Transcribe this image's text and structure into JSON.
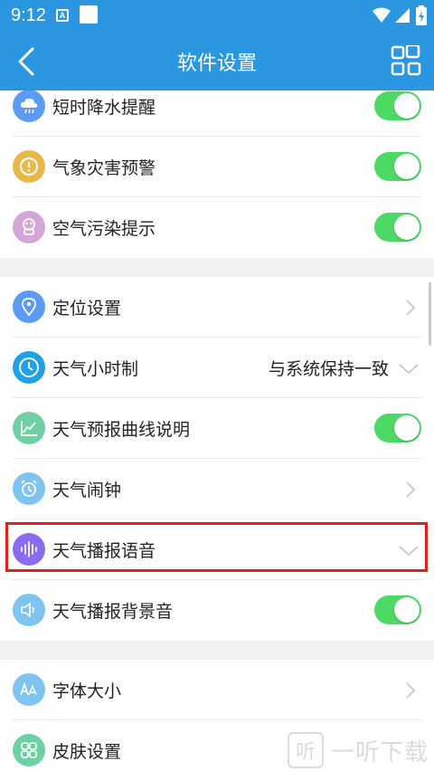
{
  "status_bar": {
    "time": "9:12",
    "notif_icon_letter": "A"
  },
  "app_bar": {
    "title": "软件设置"
  },
  "colors": {
    "accent": "#2a97e0",
    "toggle_on": "#4cd964",
    "highlight": "#e0201c"
  },
  "settings": {
    "items": [
      {
        "label": "短时降水提醒",
        "icon": "cloud-rain-icon",
        "icon_color": "#5b9bf5",
        "control": "toggle",
        "toggle_on": true
      },
      {
        "label": "气象灾害预警",
        "icon": "warning-icon",
        "icon_color": "#e8b84a",
        "control": "toggle",
        "toggle_on": true
      },
      {
        "label": "空气污染提示",
        "icon": "mask-icon",
        "icon_color": "#d4a6d6",
        "control": "toggle",
        "toggle_on": true
      },
      {
        "label": "定位设置",
        "icon": "location-pin-icon",
        "icon_color": "#5b9bf5",
        "control": "chevron-right"
      },
      {
        "label": "天气小时制",
        "icon": "clock-icon",
        "icon_color": "#1fa0e8",
        "control": "dropdown",
        "value": "与系统保持一致"
      },
      {
        "label": "天气预报曲线说明",
        "icon": "chart-curve-icon",
        "icon_color": "#6fd0a6",
        "control": "toggle",
        "toggle_on": true
      },
      {
        "label": "天气闹钟",
        "icon": "alarm-clock-icon",
        "icon_color": "#7fc4f0",
        "control": "chevron-right"
      },
      {
        "label": "天气播报语音",
        "icon": "sound-wave-icon",
        "icon_color": "#8b6cf0",
        "control": "dropdown",
        "value": ""
      },
      {
        "label": "天气播报背景音",
        "icon": "speaker-icon",
        "icon_color": "#7fc4f0",
        "control": "toggle",
        "toggle_on": true
      },
      {
        "label": "字体大小",
        "icon": "font-size-icon",
        "icon_color": "#7fc4f0",
        "control": "chevron-right"
      },
      {
        "label": "皮肤设置",
        "icon": "skin-grid-icon",
        "icon_color": "#6fd0a6",
        "control": "chevron-right"
      }
    ]
  },
  "watermark": {
    "glyph": "听",
    "text": "一听下载"
  }
}
